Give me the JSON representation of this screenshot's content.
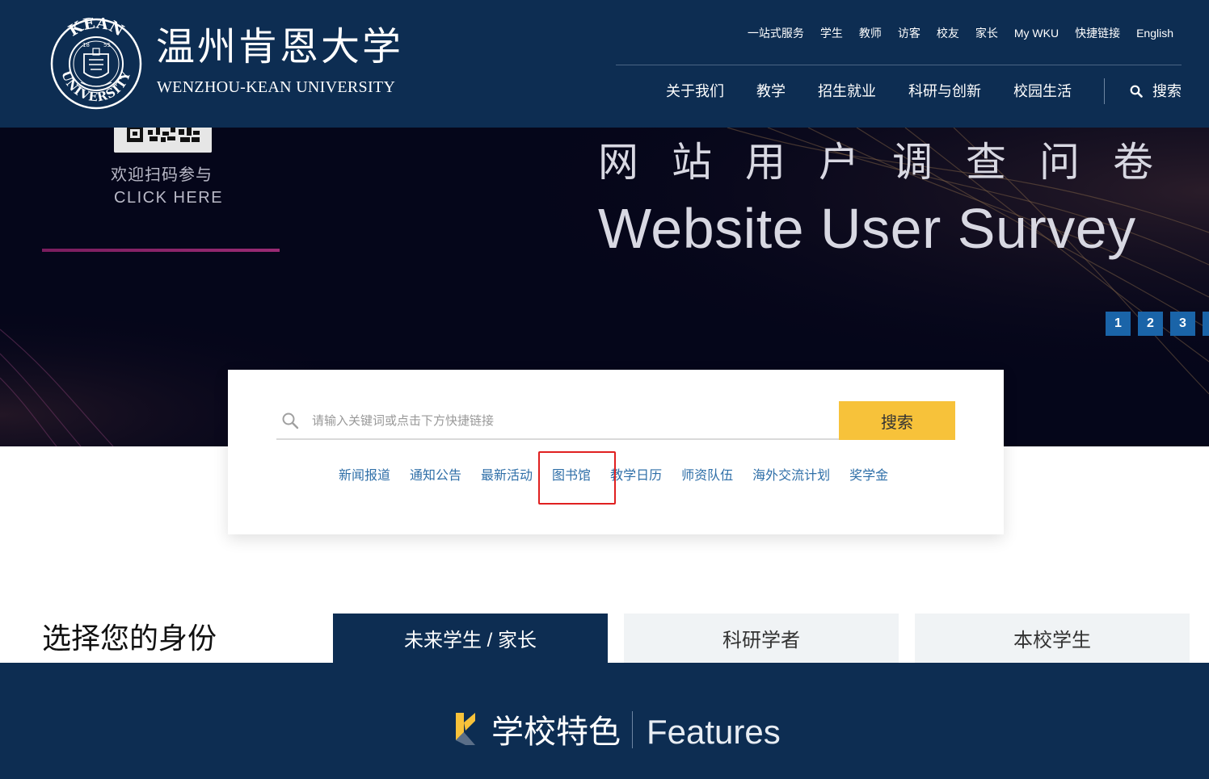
{
  "header": {
    "logo_cn": "温州肯恩大学",
    "logo_en": "WENZHOU-KEAN UNIVERSITY",
    "seal": {
      "text": "KEAN UNIVERSITY",
      "year_left": "18",
      "year_right": "55"
    },
    "utility_links": [
      "一站式服务",
      "学生",
      "教师",
      "访客",
      "校友",
      "家长",
      "My WKU",
      "快捷链接",
      "English"
    ],
    "main_nav": [
      "关于我们",
      "教学",
      "招生就业",
      "科研与创新",
      "校园生活"
    ],
    "search_label": "搜索"
  },
  "hero": {
    "qr_welcome": "欢迎扫码参与",
    "qr_click": "CLICK HERE",
    "survey_cn": "网站用户调查问卷",
    "survey_en": "Website User Survey",
    "pages": [
      "1",
      "2",
      "3"
    ]
  },
  "search": {
    "placeholder": "请输入关键词或点击下方快捷链接",
    "button": "搜索",
    "quick_links": [
      "新闻报道",
      "通知公告",
      "最新活动",
      "图书馆",
      "教学日历",
      "师资队伍",
      "海外交流计划",
      "奖学金"
    ]
  },
  "identity": {
    "title": "选择您的身份",
    "tabs": [
      "未来学生 / 家长",
      "科研学者",
      "本校学生"
    ]
  },
  "features": {
    "title_cn": "学校特色",
    "title_en": "Features"
  },
  "colors": {
    "navy": "#0d2d52",
    "accent_yellow": "#f7c23a",
    "link_blue": "#2f6fa8",
    "pager_blue": "#1a64a8",
    "highlight_red": "#e02020"
  }
}
